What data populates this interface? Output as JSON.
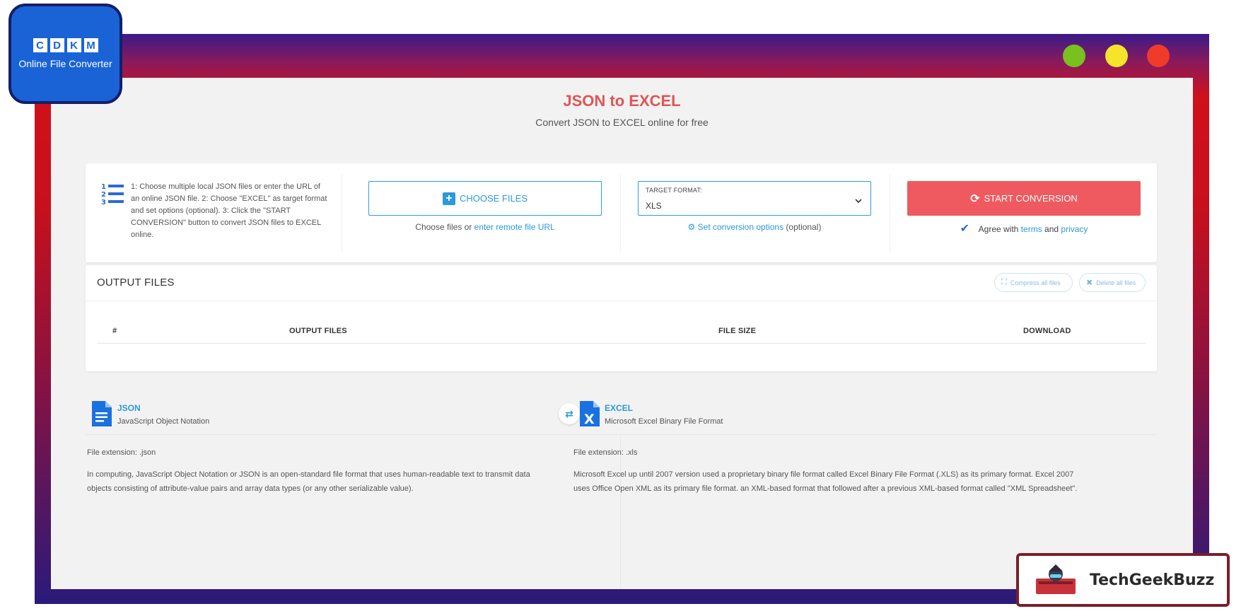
{
  "window": {
    "colors": {
      "green": "#78c11e",
      "yellow": "#f5e42a",
      "red": "#f03a2a"
    }
  },
  "logo": {
    "letters": [
      "C",
      "D",
      "K",
      "M"
    ],
    "text": "Online File Converter"
  },
  "watermark": {
    "text": "TechGeekBuzz"
  },
  "header": {
    "title": "JSON to EXCEL",
    "subtitle": "Convert JSON to EXCEL online for free"
  },
  "converter": {
    "steps_text": "1: Choose multiple local JSON files or enter the URL of an online JSON file. 2: Choose \"EXCEL\" as target format and set options (optional). 3: Click the \"START CONVERSION\" button to convert JSON files to EXCEL online.",
    "choose_files_label": "CHOOSE FILES",
    "choose_prefix": "Choose files or",
    "remote_url_link": "enter remote file URL",
    "target_format_label": "TARGET FORMAT:",
    "target_format_value": "XLS",
    "set_options_link": "Set conversion options",
    "set_options_suffix": "(optional)",
    "start_label": "START CONVERSION",
    "agree_prefix": "Agree with",
    "terms_link": "terms",
    "agree_and": "and",
    "privacy_link": "privacy"
  },
  "output": {
    "title": "OUTPUT FILES",
    "compress_label": "Compress all files",
    "delete_label": "Delete all files",
    "columns": [
      "#",
      "OUTPUT FILES",
      "FILE SIZE",
      "DOWNLOAD"
    ]
  },
  "formats": {
    "source": {
      "name": "JSON",
      "full_name": "JavaScript Object Notation",
      "extension": "File extension: .json",
      "description": "In computing, JavaScript Object Notation or JSON is an open-standard file format that uses human-readable text to transmit data objects consisting of attribute-value pairs and array data types (or any other serializable value)."
    },
    "target": {
      "name": "EXCEL",
      "full_name": "Microsoft Excel Binary File Format",
      "extension": "File extension: .xls",
      "description": "Microsoft Excel up until 2007 version used a proprietary binary file format called Excel Binary File Format (.XLS) as its primary format. Excel 2007 uses Office Open XML as its primary file format. an XML-based format that followed after a previous XML-based format called \"XML Spreadsheet\"."
    }
  }
}
